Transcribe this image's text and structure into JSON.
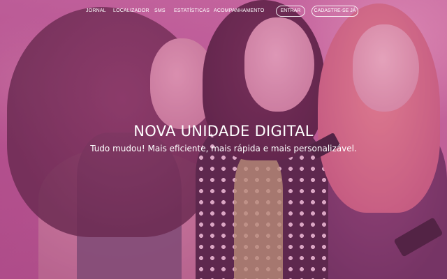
{
  "nav": {
    "links": [
      "JORNAL",
      "LOCALIZADOR",
      "SMS",
      "ESTATÍSTICAS",
      "ACOMPANHAMENTO"
    ],
    "login_button": "ENTRAR",
    "signup_button": "CADASTRE-SE JÁ"
  },
  "hero": {
    "title": "NOVA UNIDADE DIGITAL",
    "subtitle": "Tudo mudou! Mais eficiente, mais rápida e mais personalizável."
  },
  "colors": {
    "overlay": "#be5096",
    "text": "#ffffff"
  }
}
